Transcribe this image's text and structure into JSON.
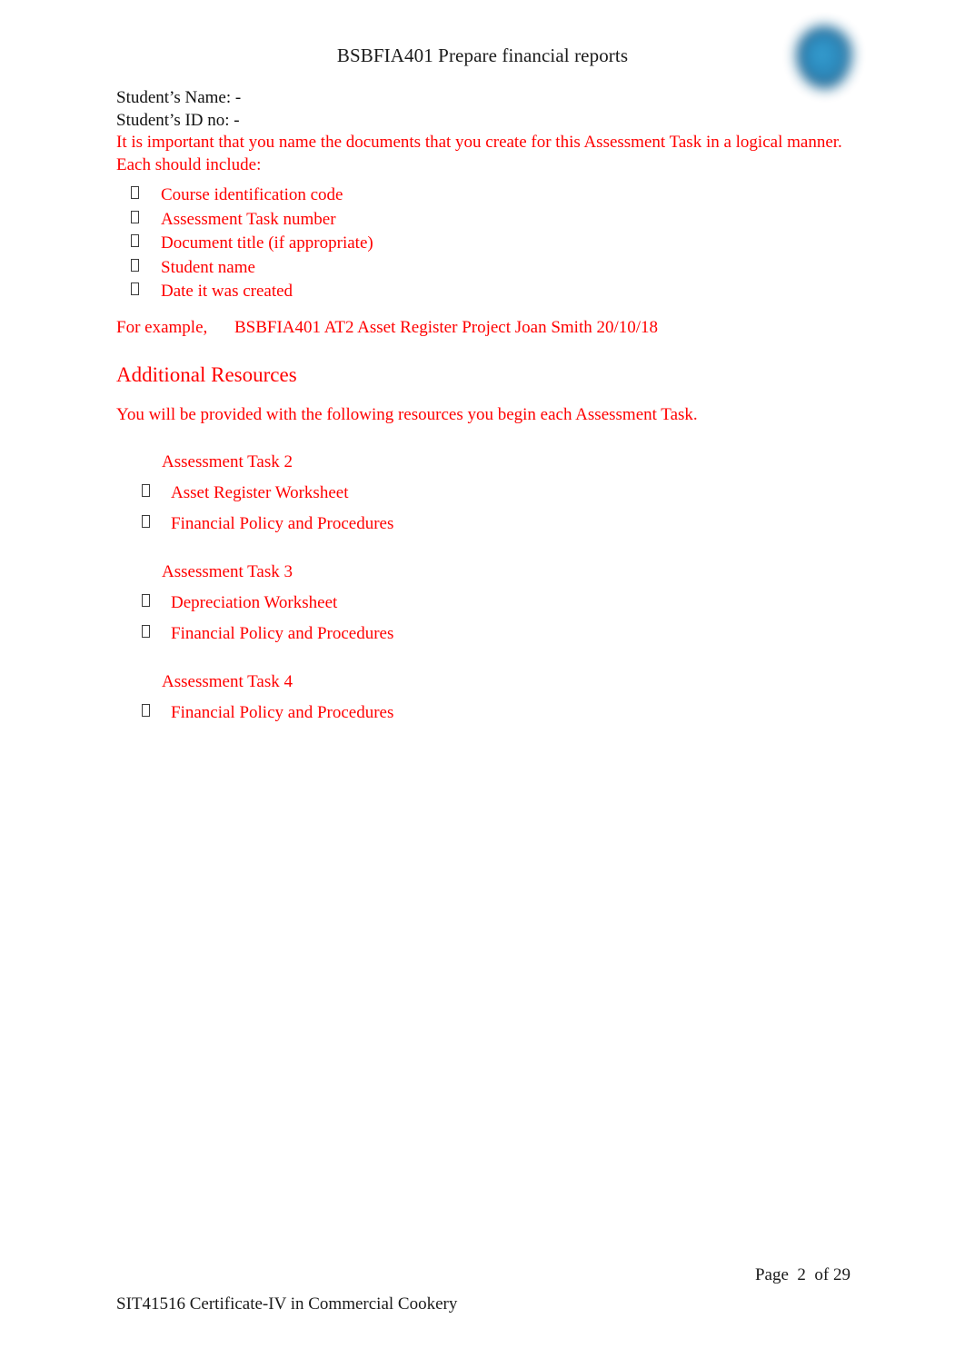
{
  "document": {
    "header_title": "BSBFIA401 Prepare financial reports",
    "logo_name": "organisation-logo"
  },
  "student": {
    "name_line": "Student’s Name: -",
    "id_line": "Student’s ID no: -"
  },
  "naming_instructions": {
    "intro_line1": "It is important that you name the documents that you create for this Assessment Task in a logical manner.",
    "intro_line2": "Each should include:",
    "items": [
      "Course identification code",
      "Assessment Task number",
      "Document title (if appropriate)",
      "Student name",
      "Date it was created"
    ],
    "example_label": "For example,",
    "example_value": "BSBFIA401 AT2 Asset Register Project Joan Smith 20/10/18"
  },
  "additional_resources": {
    "heading": "Additional Resources",
    "intro": "You will be provided with the following resources you begin each Assessment Task.",
    "groups": [
      {
        "title": "Assessment Task 2",
        "items": [
          "Asset Register Worksheet",
          "Financial Policy and Procedures"
        ]
      },
      {
        "title": "Assessment Task 3",
        "items": [
          "Depreciation Worksheet",
          "Financial Policy and Procedures"
        ]
      },
      {
        "title": "Assessment Task 4",
        "items": [
          "Financial Policy and Procedures"
        ]
      }
    ]
  },
  "footer": {
    "page_text": "Page  2  of 29",
    "course_text": "SIT41516 Certificate-IV in Commercial Cookery"
  },
  "colors": {
    "red": "#ff0000",
    "text": "#111111",
    "logo_blue": "#2a86b8"
  }
}
